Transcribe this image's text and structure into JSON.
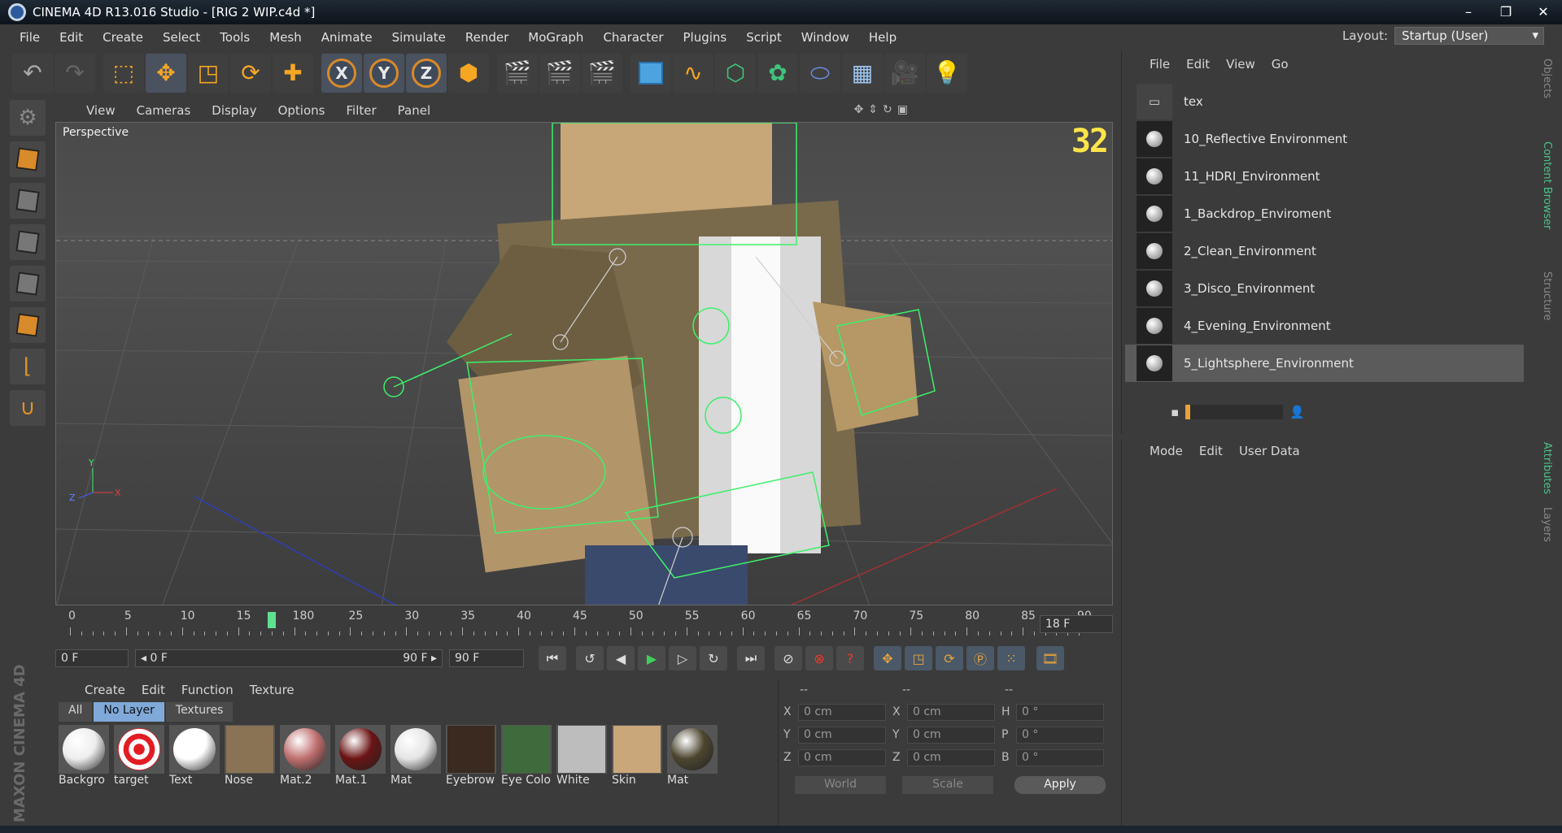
{
  "window": {
    "title": "CINEMA 4D R13.016 Studio - [RIG 2 WIP.c4d *]",
    "controls": [
      "–",
      "❐",
      "✕"
    ]
  },
  "menu": [
    "File",
    "Edit",
    "Create",
    "Select",
    "Tools",
    "Mesh",
    "Animate",
    "Simulate",
    "Render",
    "MoGraph",
    "Character",
    "Plugins",
    "Script",
    "Window",
    "Help"
  ],
  "layout": {
    "label": "Layout:",
    "value": "Startup (User)"
  },
  "viewport": {
    "menu": [
      "View",
      "Cameras",
      "Display",
      "Options",
      "Filter",
      "Panel"
    ],
    "label": "Perspective",
    "fps": "32"
  },
  "timeline": {
    "ticks": [
      "0",
      "5",
      "10",
      "15",
      "180",
      "25",
      "30",
      "35",
      "40",
      "45",
      "50",
      "55",
      "60",
      "65",
      "70",
      "75",
      "80",
      "85",
      "90"
    ],
    "current_frame": "18 F",
    "playhead_frame": 18,
    "max_frame": 90
  },
  "transport": {
    "start": "0 F",
    "range_start": "◂ 0 F",
    "range_end": "90 F ▸",
    "end": "90 F"
  },
  "materials": {
    "menu": [
      "Create",
      "Edit",
      "Function",
      "Texture"
    ],
    "tabs": [
      "All",
      "No Layer",
      "Textures"
    ],
    "items": [
      {
        "name": "Backgro",
        "kind": "ball",
        "color": "#eeeeee"
      },
      {
        "name": "target",
        "kind": "target",
        "color": "#e31b23"
      },
      {
        "name": "Text",
        "kind": "ball",
        "color": "#ffffff"
      },
      {
        "name": "Nose",
        "kind": "tile",
        "color": "#8a7355"
      },
      {
        "name": "Mat.2",
        "kind": "ball",
        "color": "#c07070"
      },
      {
        "name": "Mat.1",
        "kind": "ball",
        "color": "#6b1414"
      },
      {
        "name": "Mat",
        "kind": "ball",
        "color": "#e5e5e5"
      },
      {
        "name": "Eyebrow",
        "kind": "tile",
        "color": "#3a2a20"
      },
      {
        "name": "Eye Colo",
        "kind": "tile",
        "color": "#3e6a3c"
      },
      {
        "name": "White",
        "kind": "tile",
        "color": "#bdbdbd"
      },
      {
        "name": "Skin",
        "kind": "tile",
        "color": "#c9a77a"
      },
      {
        "name": "Mat",
        "kind": "ball",
        "color": "#4c4630"
      }
    ]
  },
  "brand": "MAXON CINEMA 4D",
  "coords": {
    "headers": [
      "--",
      "--",
      "--"
    ],
    "rows": [
      [
        {
          "l": "X",
          "v": "0 cm"
        },
        {
          "l": "X",
          "v": "0 cm"
        },
        {
          "l": "H",
          "v": "0 °"
        }
      ],
      [
        {
          "l": "Y",
          "v": "0 cm"
        },
        {
          "l": "Y",
          "v": "0 cm"
        },
        {
          "l": "P",
          "v": "0 °"
        }
      ],
      [
        {
          "l": "Z",
          "v": "0 cm"
        },
        {
          "l": "Z",
          "v": "0 cm"
        },
        {
          "l": "B",
          "v": "0 °"
        }
      ]
    ],
    "space": "World",
    "mode": "Scale",
    "apply": "Apply"
  },
  "objects": {
    "menu": [
      "File",
      "Edit",
      "View",
      "Go"
    ],
    "items": [
      "tex",
      "10_Reflective Environment",
      "11_HDRI_Environment",
      "1_Backdrop_Enviroment",
      "2_Clean_Environment",
      "3_Disco_Environment",
      "4_Evening_Environment",
      "5_Lightsphere_Environment"
    ],
    "selected_index": 7
  },
  "attributes": {
    "menu": [
      "Mode",
      "Edit",
      "User Data"
    ]
  },
  "side_tabs": [
    "Objects",
    "Content Browser",
    "Structure",
    "Attributes",
    "Layers"
  ]
}
